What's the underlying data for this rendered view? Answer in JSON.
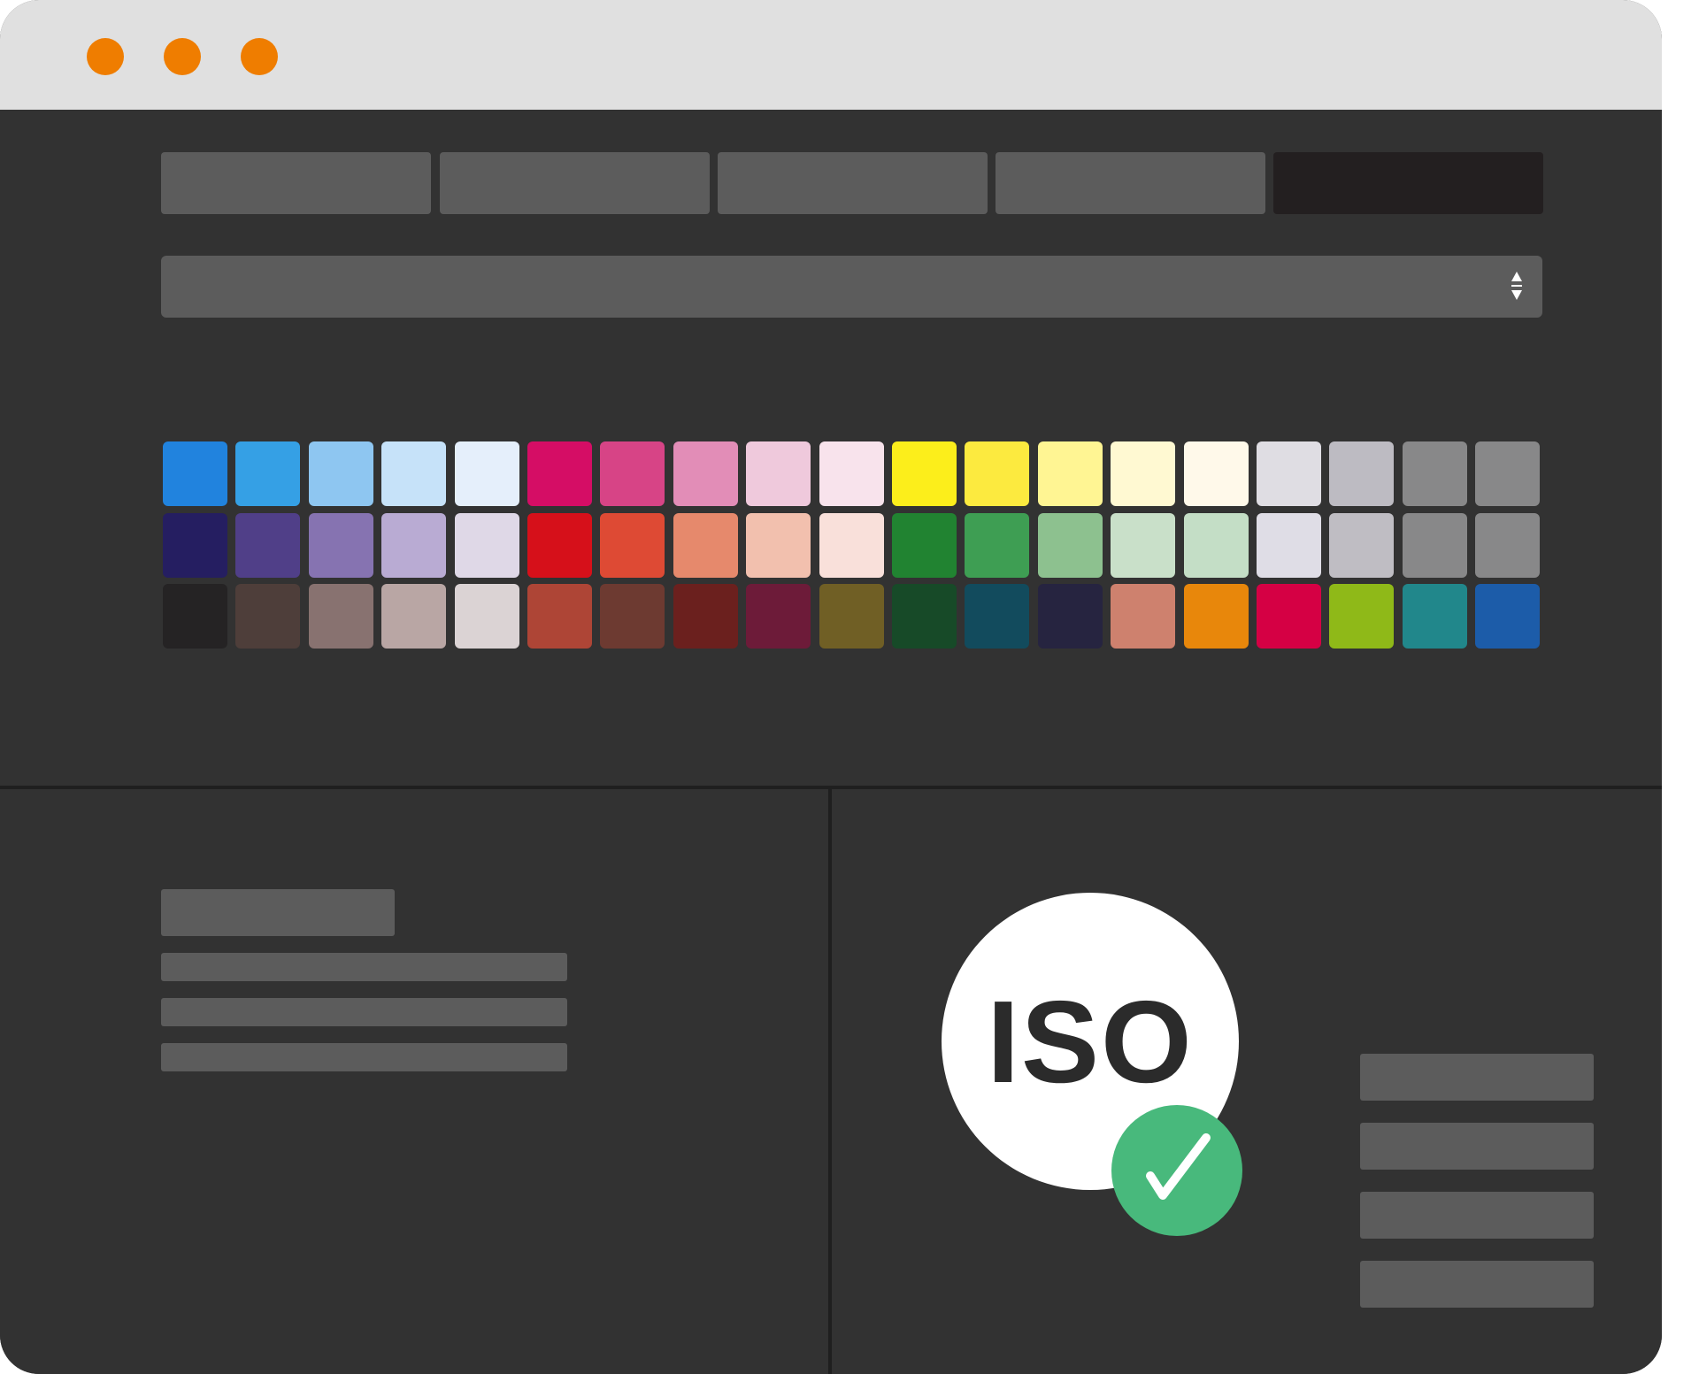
{
  "colors": {
    "titlebar": "#e0e0e0",
    "window_bg": "#323232",
    "placeholder": "#5c5c5c",
    "active_tab": "#231f20",
    "traffic_dot": "#ef7d00",
    "check_badge": "#48b97c"
  },
  "window": {
    "controls": [
      "window-dot",
      "window-dot",
      "window-dot"
    ]
  },
  "tabs": [
    {
      "state": "inactive"
    },
    {
      "state": "inactive"
    },
    {
      "state": "inactive"
    },
    {
      "state": "inactive"
    },
    {
      "state": "active"
    }
  ],
  "dropdown": {
    "icon": "updown-arrows-icon",
    "value": ""
  },
  "swatches": {
    "rows": [
      [
        "#2183de",
        "#35a0e5",
        "#8ec6f1",
        "#c6e2f9",
        "#e5effb",
        "#d50d65",
        "#d74486",
        "#e28db7",
        "#efc9dc",
        "#f8e3ec",
        "#fcee1b",
        "#fcea3f",
        "#fff593",
        "#fff9d2",
        "#fff9ea",
        "#dfdde3",
        "#bdbbc2",
        "#888889",
        "#888889"
      ],
      [
        "#251e61",
        "#503f88",
        "#8673b1",
        "#b9abd3",
        "#dfd8e7",
        "#d6101a",
        "#de4a34",
        "#e6896c",
        "#f2c0ae",
        "#f9e0da",
        "#218331",
        "#3e9e53",
        "#8dc18f",
        "#c9e0c9",
        "#c4dec6",
        "#dfdde6",
        "#bfbdc3",
        "#888889",
        "#888889"
      ],
      [
        "#252324",
        "#4e3e3a",
        "#887270",
        "#b9a6a4",
        "#dbd3d4",
        "#ae4536",
        "#6d3a31",
        "#6b201e",
        "#6d1b39",
        "#705f25",
        "#174a28",
        "#124b5d",
        "#262440",
        "#ce816e",
        "#e8870b",
        "#d50044",
        "#8fb918",
        "#21878b",
        "#1c5ca9"
      ]
    ]
  },
  "left_panel": {
    "bars": [
      "heading-placeholder",
      "text-line-placeholder",
      "text-line-placeholder",
      "text-line-placeholder"
    ]
  },
  "right_panel": {
    "badge_text": "ISO",
    "badge_icon": "check-icon",
    "bars": [
      "list-placeholder",
      "list-placeholder",
      "list-placeholder",
      "list-placeholder"
    ]
  }
}
